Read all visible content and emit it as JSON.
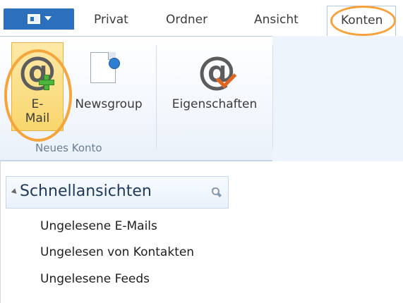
{
  "tabs": {
    "file_icon": "file-menu-icon",
    "items": [
      "Privat",
      "Ordner",
      "Ansicht",
      "Konten"
    ],
    "active": "Konten"
  },
  "ribbon": {
    "group_label": "Neues Konto",
    "buttons": {
      "email": "E-\nMail",
      "email_line1": "E-",
      "email_line2": "Mail",
      "newsgroup": "Newsgroup",
      "properties": "Eigenschaften"
    }
  },
  "quick_views": {
    "title": "Schnellansichten",
    "items": [
      "Ungelesene E-Mails",
      "Ungelesen von Kontakten",
      "Ungelesene Feeds"
    ]
  },
  "colors": {
    "highlight_ring": "#f5a53c",
    "file_button": "#2b6fbd",
    "selected_button": "#f9d66d"
  }
}
